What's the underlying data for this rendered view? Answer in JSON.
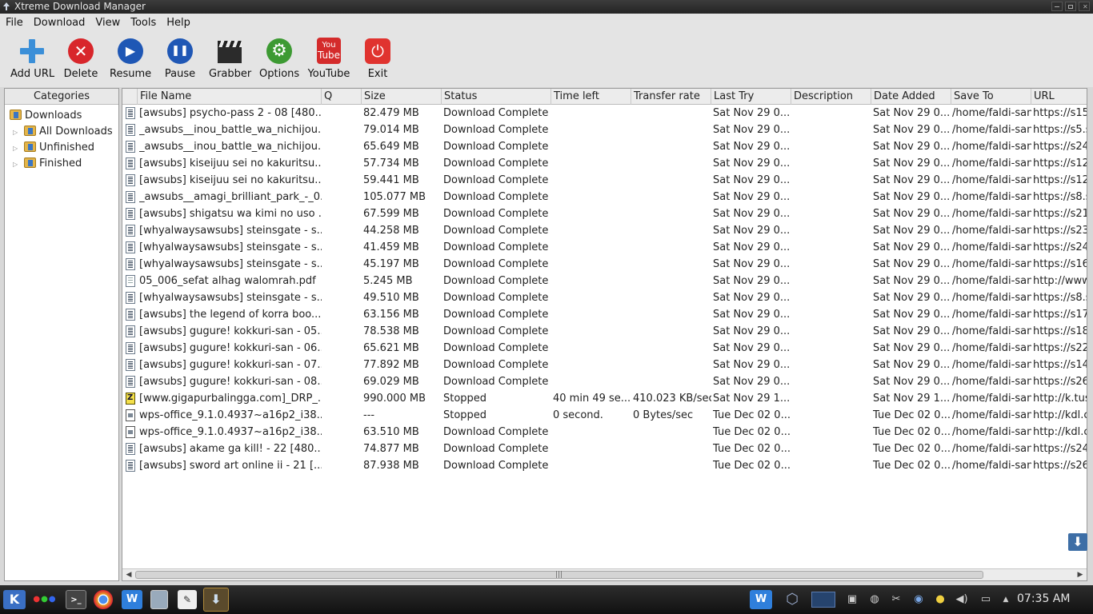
{
  "window": {
    "title": "Xtreme Download Manager"
  },
  "menu": [
    "File",
    "Download",
    "View",
    "Tools",
    "Help"
  ],
  "toolbar": [
    {
      "id": "add-url",
      "label": "Add URL",
      "icon": "add-icon",
      "color": "#3b8fd8",
      "glyph": "+"
    },
    {
      "id": "delete",
      "label": "Delete",
      "icon": "delete-icon",
      "color": "#d8262b",
      "glyph": "✕"
    },
    {
      "id": "resume",
      "label": "Resume",
      "icon": "play-icon",
      "color": "#1f57b5",
      "glyph": "▶"
    },
    {
      "id": "pause",
      "label": "Pause",
      "icon": "pause-icon",
      "color": "#1f57b5",
      "glyph": "❚❚"
    },
    {
      "id": "grabber",
      "label": "Grabber",
      "icon": "clapperboard-icon",
      "color": "#2b2b2b",
      "glyph": ""
    },
    {
      "id": "options",
      "label": "Options",
      "icon": "gear-icon",
      "color": "#3d9a33",
      "glyph": "⚙"
    },
    {
      "id": "youtube",
      "label": "YouTube",
      "icon": "youtube-icon",
      "color": "#d42b2b",
      "glyph": "You Tube"
    },
    {
      "id": "exit",
      "label": "Exit",
      "icon": "power-icon",
      "color": "#e0332f",
      "glyph": "⏻"
    }
  ],
  "categories": {
    "header": "Categories",
    "root": "Downloads",
    "items": [
      "All Downloads",
      "Unfinished",
      "Finished"
    ]
  },
  "columns": [
    "File Name",
    "Q",
    "Size",
    "Status",
    "Time left",
    "Transfer rate",
    "Last Try",
    "Description",
    "Date Added",
    "Save To",
    "URL"
  ],
  "rows": [
    {
      "icon": "video",
      "name": "[awsubs] psycho-pass 2 - 08 [480...",
      "size": "82.479 MB",
      "status": "Download Complete",
      "time": "",
      "rate": "",
      "last": "Sat Nov 29 0...",
      "desc": "",
      "added": "Sat Nov 29 0...",
      "save": "/home/faldi-san",
      "url": "https://s15"
    },
    {
      "icon": "video",
      "name": "_awsubs__inou_battle_wa_nichijou...",
      "size": "79.014 MB",
      "status": "Download Complete",
      "time": "",
      "rate": "",
      "last": "Sat Nov 29 0...",
      "desc": "",
      "added": "Sat Nov 29 0...",
      "save": "/home/faldi-san",
      "url": "https://s5.s"
    },
    {
      "icon": "video",
      "name": "_awsubs__inou_battle_wa_nichijou...",
      "size": "65.649 MB",
      "status": "Download Complete",
      "time": "",
      "rate": "",
      "last": "Sat Nov 29 0...",
      "desc": "",
      "added": "Sat Nov 29 0...",
      "save": "/home/faldi-san",
      "url": "https://s24"
    },
    {
      "icon": "video",
      "name": "[awsubs] kiseijuu sei no kakuritsu...",
      "size": "57.734 MB",
      "status": "Download Complete",
      "time": "",
      "rate": "",
      "last": "Sat Nov 29 0...",
      "desc": "",
      "added": "Sat Nov 29 0...",
      "save": "/home/faldi-san",
      "url": "https://s12"
    },
    {
      "icon": "video",
      "name": "[awsubs] kiseijuu sei no kakuritsu...",
      "size": "59.441 MB",
      "status": "Download Complete",
      "time": "",
      "rate": "",
      "last": "Sat Nov 29 0...",
      "desc": "",
      "added": "Sat Nov 29 0...",
      "save": "/home/faldi-san",
      "url": "https://s12"
    },
    {
      "icon": "video",
      "name": "_awsubs__amagi_brilliant_park_-_0...",
      "size": "105.077 MB",
      "status": "Download Complete",
      "time": "",
      "rate": "",
      "last": "Sat Nov 29 0...",
      "desc": "",
      "added": "Sat Nov 29 0...",
      "save": "/home/faldi-san",
      "url": "https://s8.s"
    },
    {
      "icon": "video",
      "name": "[awsubs] shigatsu wa kimi no uso ...",
      "size": "67.599 MB",
      "status": "Download Complete",
      "time": "",
      "rate": "",
      "last": "Sat Nov 29 0...",
      "desc": "",
      "added": "Sat Nov 29 0...",
      "save": "/home/faldi-san",
      "url": "https://s21"
    },
    {
      "icon": "video",
      "name": "[whyalwaysawsubs] steinsgate - s...",
      "size": "44.258 MB",
      "status": "Download Complete",
      "time": "",
      "rate": "",
      "last": "Sat Nov 29 0...",
      "desc": "",
      "added": "Sat Nov 29 0...",
      "save": "/home/faldi-san",
      "url": "https://s23"
    },
    {
      "icon": "video",
      "name": "[whyalwaysawsubs] steinsgate - s...",
      "size": "41.459 MB",
      "status": "Download Complete",
      "time": "",
      "rate": "",
      "last": "Sat Nov 29 0...",
      "desc": "",
      "added": "Sat Nov 29 0...",
      "save": "/home/faldi-san",
      "url": "https://s24"
    },
    {
      "icon": "video",
      "name": "[whyalwaysawsubs] steinsgate - s...",
      "size": "45.197 MB",
      "status": "Download Complete",
      "time": "",
      "rate": "",
      "last": "Sat Nov 29 0...",
      "desc": "",
      "added": "Sat Nov 29 0...",
      "save": "/home/faldi-san",
      "url": "https://s16"
    },
    {
      "icon": "doc",
      "name": "05_006_sefat alhag walomrah.pdf",
      "size": "5.245 MB",
      "status": "Download Complete",
      "time": "",
      "rate": "",
      "last": "Sat Nov 29 0...",
      "desc": "",
      "added": "Sat Nov 29 0...",
      "save": "/home/faldi-san",
      "url": "http://www."
    },
    {
      "icon": "video",
      "name": "[whyalwaysawsubs] steinsgate - s...",
      "size": "49.510 MB",
      "status": "Download Complete",
      "time": "",
      "rate": "",
      "last": "Sat Nov 29 0...",
      "desc": "",
      "added": "Sat Nov 29 0...",
      "save": "/home/faldi-san",
      "url": "https://s8.s"
    },
    {
      "icon": "video",
      "name": "[awsubs] the legend of korra boo...",
      "size": "63.156 MB",
      "status": "Download Complete",
      "time": "",
      "rate": "",
      "last": "Sat Nov 29 0...",
      "desc": "",
      "added": "Sat Nov 29 0...",
      "save": "/home/faldi-san",
      "url": "https://s17"
    },
    {
      "icon": "video",
      "name": "[awsubs] gugure! kokkuri-san - 05...",
      "size": "78.538 MB",
      "status": "Download Complete",
      "time": "",
      "rate": "",
      "last": "Sat Nov 29 0...",
      "desc": "",
      "added": "Sat Nov 29 0...",
      "save": "/home/faldi-san",
      "url": "https://s18"
    },
    {
      "icon": "video",
      "name": "[awsubs] gugure! kokkuri-san - 06...",
      "size": "65.621 MB",
      "status": "Download Complete",
      "time": "",
      "rate": "",
      "last": "Sat Nov 29 0...",
      "desc": "",
      "added": "Sat Nov 29 0...",
      "save": "/home/faldi-san",
      "url": "https://s22"
    },
    {
      "icon": "video",
      "name": "[awsubs] gugure! kokkuri-san - 07...",
      "size": "77.892 MB",
      "status": "Download Complete",
      "time": "",
      "rate": "",
      "last": "Sat Nov 29 0...",
      "desc": "",
      "added": "Sat Nov 29 0...",
      "save": "/home/faldi-san",
      "url": "https://s14"
    },
    {
      "icon": "video",
      "name": "[awsubs] gugure! kokkuri-san - 08...",
      "size": "69.029 MB",
      "status": "Download Complete",
      "time": "",
      "rate": "",
      "last": "Sat Nov 29 0...",
      "desc": "",
      "added": "Sat Nov 29 0...",
      "save": "/home/faldi-san",
      "url": "https://s26"
    },
    {
      "icon": "zip",
      "name": "[www.gigapurbalingga.com]_DRP_...",
      "size": "990.000 MB",
      "status": "Stopped",
      "time": "40 min 49 se...",
      "rate": "410.023 KB/sec",
      "last": "Sat Nov 29 1...",
      "desc": "",
      "added": "Sat Nov 29 1...",
      "save": "/home/faldi-san",
      "url": "http://k.tus"
    },
    {
      "icon": "pkg",
      "name": "wps-office_9.1.0.4937~a16p2_i38...",
      "size": "---",
      "status": "Stopped",
      "time": "0 second.",
      "rate": "0 Bytes/sec",
      "last": "Tue Dec 02 0...",
      "desc": "",
      "added": "Tue Dec 02 0...",
      "save": "/home/faldi-san",
      "url": "http://kdl.c"
    },
    {
      "icon": "pkg",
      "name": "wps-office_9.1.0.4937~a16p2_i38...",
      "size": "63.510 MB",
      "status": "Download Complete",
      "time": "",
      "rate": "",
      "last": "Tue Dec 02 0...",
      "desc": "",
      "added": "Tue Dec 02 0...",
      "save": "/home/faldi-san",
      "url": "http://kdl.c"
    },
    {
      "icon": "video",
      "name": "[awsubs] akame ga kill! - 22 [480...",
      "size": "74.877 MB",
      "status": "Download Complete",
      "time": "",
      "rate": "",
      "last": "Tue Dec 02 0...",
      "desc": "",
      "added": "Tue Dec 02 0...",
      "save": "/home/faldi-san",
      "url": "https://s24"
    },
    {
      "icon": "video",
      "name": "[awsubs] sword art online ii - 21 [...",
      "size": "87.938 MB",
      "status": "Download Complete",
      "time": "",
      "rate": "",
      "last": "Tue Dec 02 0...",
      "desc": "",
      "added": "Tue Dec 02 0...",
      "save": "/home/faldi-san",
      "url": "https://s26"
    }
  ],
  "taskbar": {
    "clock": "07:35 AM",
    "launchers": [
      "kde-menu-icon",
      "activities-icon",
      "terminal-icon",
      "chrome-icon",
      "wps-writer-icon",
      "file-manager-icon",
      "text-editor-icon",
      "xdman-icon"
    ],
    "tray": [
      "wps-icon",
      "virtualbox-icon",
      "screen-icon",
      "clipboard-icon",
      "network-icon",
      "scissors-icon",
      "kde-connect-icon",
      "bulb-icon",
      "volume-icon",
      "display-icon",
      "tray-expand-icon"
    ]
  },
  "colors": {
    "accent": "#3b8fd8",
    "taskbar": "#1a1a1a",
    "window_bg": "#e4e4e4"
  }
}
